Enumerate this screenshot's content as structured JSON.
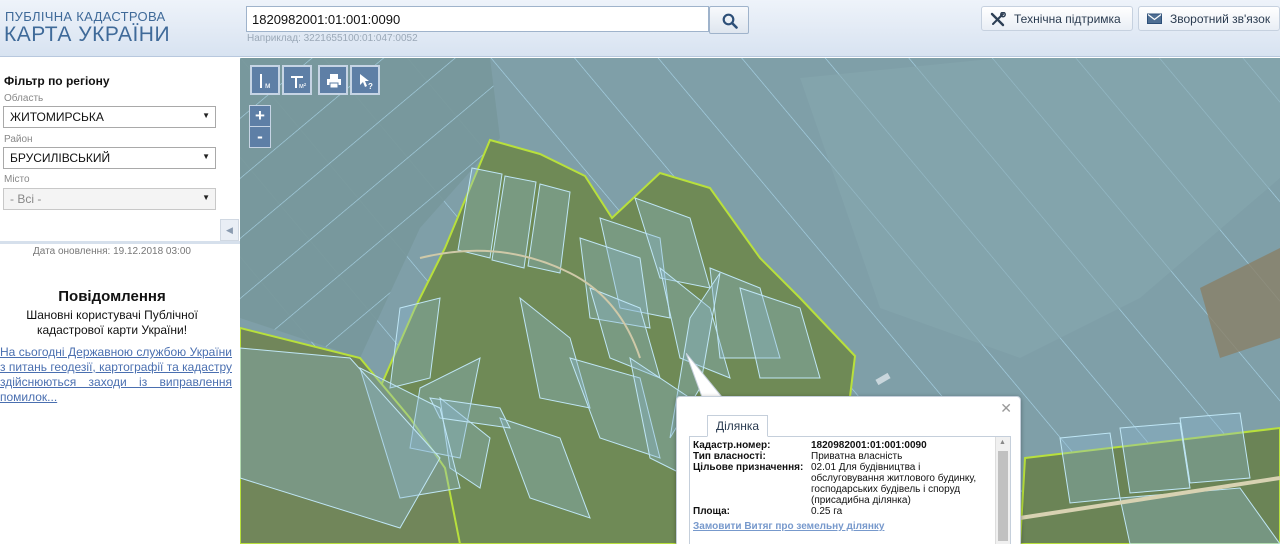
{
  "header": {
    "logo_line1": "ПУБЛІЧНА КАДАСТРОВА",
    "logo_line2": "КАРТА УКРАЇНИ",
    "search": {
      "value": "1820982001:01:001:0090",
      "hint": "Наприклад: 3221655100:01:047:0052"
    },
    "support_label": "Технічна підтримка",
    "feedback_label": "Зворотний зв'язок"
  },
  "sidebar": {
    "filter_title": "Фільтр по регіону",
    "region_label": "Область",
    "region_value": "ЖИТОМИРСЬКА",
    "district_label": "Район",
    "district_value": "БРУСИЛІВСЬКИЙ",
    "city_label": "Місто",
    "city_value": "- Всі -",
    "update_date": "Дата оновлення: 19.12.2018 03:00",
    "notice_title": "Повідомлення",
    "notice_greeting": "Шановні користувачі Публічної кадастрової карти України!",
    "notice_link": "На сьогодні Державною службою України з питань геодезії, картографії та кадастру здійснюються заходи із виправлення помилок..."
  },
  "map": {
    "tools": [
      "ruler-icon",
      "area-ruler-icon",
      "print-icon",
      "identify-icon"
    ],
    "zoom_in": "+",
    "zoom_out": "-",
    "colors": {
      "parcel_line": "#8fd0ee",
      "boundary": "#b8e03c",
      "field": "#7d9ea6"
    }
  },
  "popup": {
    "tab_label": "Ділянка",
    "rows": [
      {
        "key": "Кадастр.номер:",
        "value": "1820982001:01:001:0090"
      },
      {
        "key": "Тип власності:",
        "value": "Приватна власність"
      },
      {
        "key": "Цільове призначення:",
        "value": "02.01 Для будівництва і обслуговування житлового будинку, господарських будівель і споруд (присадибна ділянка)"
      },
      {
        "key": "Площа:",
        "value": "0.25 га"
      }
    ],
    "order_link": "Замовити Витяг про земельну ділянку"
  }
}
